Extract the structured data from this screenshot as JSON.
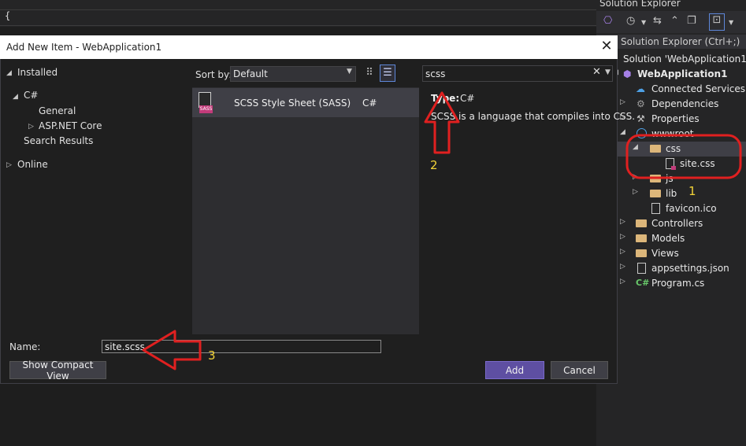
{
  "editor": {
    "code_fragment": "{"
  },
  "solution_explorer": {
    "title": "Solution Explorer",
    "search_placeholder": "ch Solution Explorer (Ctrl+;)",
    "solution_label": "Solution 'WebApplication1'",
    "project": "WebApplication1",
    "items": {
      "connected_services": "Connected Services",
      "dependencies": "Dependencies",
      "properties": "Properties",
      "wwwroot": "wwwroot",
      "css": "css",
      "site_css": "site.css",
      "js": "js",
      "lib": "lib",
      "favicon": "favicon.ico",
      "controllers": "Controllers",
      "models": "Models",
      "views": "Views",
      "appsettings": "appsettings.json",
      "program": "Program.cs"
    }
  },
  "dialog": {
    "title": "Add New Item - WebApplication1",
    "close_glyph": "✕",
    "left_tree": {
      "installed": "Installed",
      "csharp": "C#",
      "general": "General",
      "aspnet": "ASP.NET Core",
      "search_results": "Search Results",
      "online": "Online"
    },
    "sort_label": "Sort by:",
    "sort_value": "Default",
    "search_value": "scss",
    "template_item": {
      "name": "SCSS Style Sheet (SASS)",
      "language": "C#",
      "badge": "SASS"
    },
    "details": {
      "type_label": "Type:",
      "type_value": "C#",
      "description": "SCSS is a language that compiles into CSS."
    },
    "name_label": "Name:",
    "name_value": "site.scss",
    "buttons": {
      "compact": "Show Compact View",
      "add": "Add",
      "cancel": "Cancel"
    }
  },
  "annotations": {
    "one": "1",
    "two": "2",
    "three": "3"
  },
  "colors": {
    "annotation_red": "#e02020",
    "annotation_yellow": "#f2d438",
    "add_button": "#5e4fa2"
  }
}
